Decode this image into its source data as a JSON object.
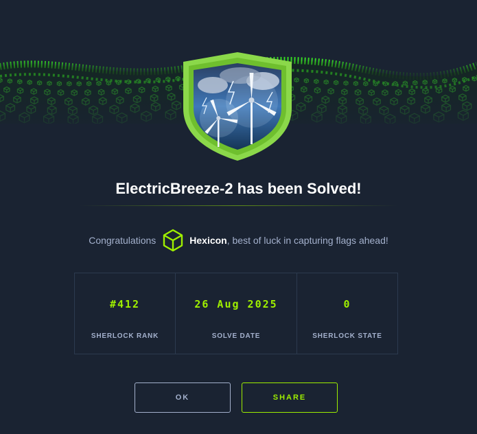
{
  "dialog": {
    "title": "ElectricBreeze-2 has been Solved!",
    "congrats_prefix": "Congratulations",
    "username": "Hexicon",
    "congrats_suffix": ", best of luck in capturing flags ahead!"
  },
  "stats": [
    {
      "value": "#412",
      "label": "SHERLOCK RANK"
    },
    {
      "value": "26 Aug 2025",
      "label": "SOLVE DATE"
    },
    {
      "value": "0",
      "label": "SHERLOCK STATE"
    }
  ],
  "buttons": {
    "ok_label": "OK",
    "share_label": "SHARE"
  },
  "icons": {
    "badge": "wind-turbine-shield-icon",
    "user": "green-cube-icon"
  },
  "colors": {
    "background": "#1a2332",
    "accent": "#9fef00",
    "muted": "#a4b1cd",
    "border": "#2c3a4f"
  }
}
